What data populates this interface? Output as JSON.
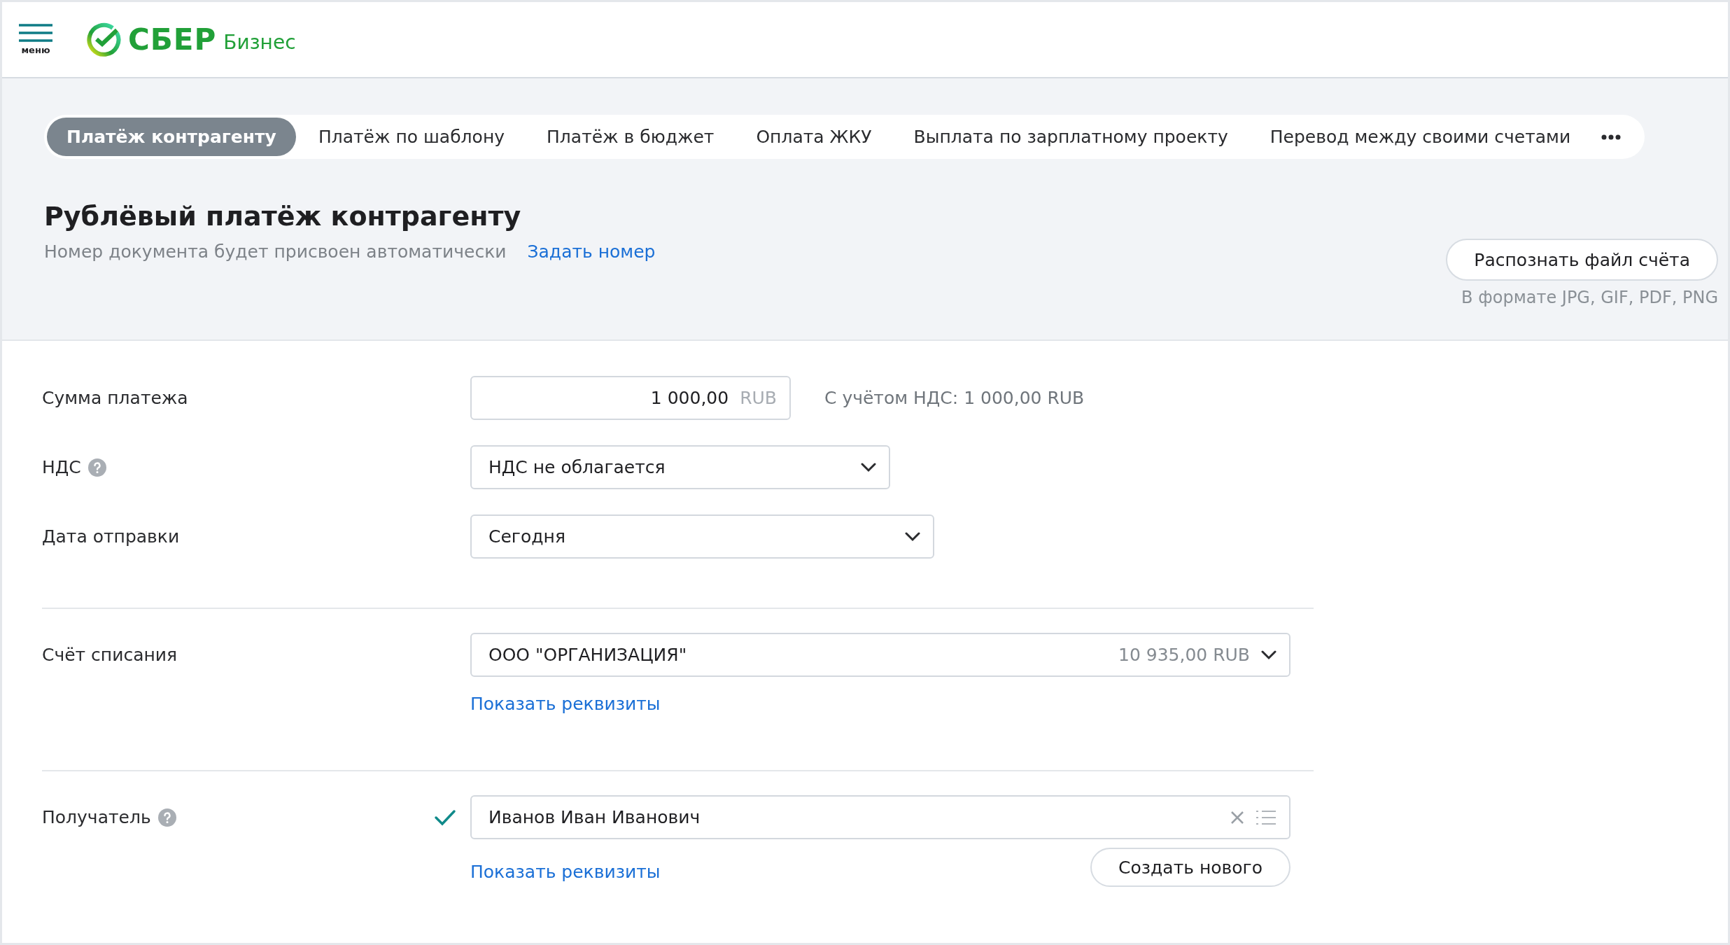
{
  "header": {
    "menu_label": "меню",
    "logo_text": "СБЕР",
    "logo_subtext": "Бизнес"
  },
  "tabs": [
    {
      "label": "Платёж контрагенту",
      "selected": true
    },
    {
      "label": "Платёж по шаблону",
      "selected": false
    },
    {
      "label": "Платёж в бюджет",
      "selected": false
    },
    {
      "label": "Оплата ЖКУ",
      "selected": false
    },
    {
      "label": "Выплата по зарплатному проекту",
      "selected": false
    },
    {
      "label": "Перевод между своими счетами",
      "selected": false
    }
  ],
  "page": {
    "title": "Рублёвый платёж контрагенту",
    "subtitle": "Номер документа будет присвоен автоматически",
    "set_number_link": "Задать номер"
  },
  "recognize": {
    "button": "Распознать файл счёта",
    "hint": "В формате JPG, GIF, PDF, PNG"
  },
  "sections": [
    [
      {
        "kind": "amount",
        "label": "Сумма платежа",
        "help": false,
        "value": "1 000,00",
        "currency": "RUB",
        "note": "С учётом НДС: 1 000,00 RUB"
      },
      {
        "kind": "select",
        "label": "НДС",
        "help": true,
        "value": "НДС не облагается"
      },
      {
        "kind": "select",
        "label": "Дата отправки",
        "help": false,
        "value": "Сегодня"
      }
    ],
    [
      {
        "kind": "account",
        "label": "Счёт списания",
        "help": false,
        "value": "ООО \"ОРГАНИЗАЦИЯ\"",
        "balance": "10 935,00 RUB",
        "link": "Показать реквизиты"
      }
    ],
    [
      {
        "kind": "recipient",
        "label": "Получатель",
        "help": true,
        "verified": true,
        "value": "Иванов Иван Иванович",
        "link": "Показать реквизиты",
        "button": "Создать нового"
      }
    ]
  ]
}
